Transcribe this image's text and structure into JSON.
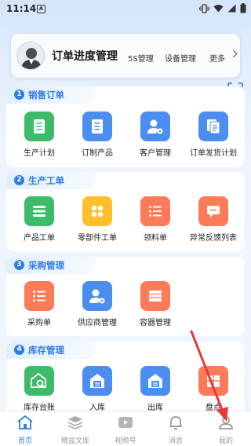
{
  "status_bar": {
    "time": "11:14",
    "notif_letter": "A"
  },
  "header": {
    "title": "订单进度管理",
    "tabs": [
      "5S管理",
      "设备管理",
      "更多"
    ]
  },
  "sections": [
    {
      "num": "1",
      "title": "销售订单",
      "items": [
        {
          "label": "生产计划",
          "color": "#3dba6a",
          "icon": "document-icon"
        },
        {
          "label": "订制产品",
          "color": "#4b8ef0",
          "icon": "document-icon"
        },
        {
          "label": "客户管理",
          "color": "#4b8ef0",
          "icon": "user-gear-icon"
        },
        {
          "label": "订单发货计划",
          "color": "#4b8ef0",
          "icon": "copy-document-icon"
        }
      ]
    },
    {
      "num": "2",
      "title": "生产工单",
      "items": [
        {
          "label": "产品工单",
          "color": "#3dba6a",
          "icon": "list-icon"
        },
        {
          "label": "零部件工单",
          "color": "#ffbf2a",
          "icon": "grid-dots-icon"
        },
        {
          "label": "领料单",
          "color": "#ff7a58",
          "icon": "list-icon"
        },
        {
          "label": "异常反馈列表",
          "color": "#ff7a58",
          "icon": "message-icon"
        }
      ]
    },
    {
      "num": "3",
      "title": "采购管理",
      "items": [
        {
          "label": "采购单",
          "color": "#ff7a58",
          "icon": "list-icon"
        },
        {
          "label": "供应商管理",
          "color": "#4b8ef0",
          "icon": "user-gear-icon"
        },
        {
          "label": "容器管理",
          "color": "#ff7a58",
          "icon": "table-icon"
        }
      ]
    },
    {
      "num": "4",
      "title": "库存管理",
      "items": [
        {
          "label": "库存台账",
          "color": "#3dba6a",
          "icon": "warehouse-search-icon"
        },
        {
          "label": "入库",
          "color": "#4b8ef0",
          "icon": "warehouse-in-icon"
        },
        {
          "label": "出库",
          "color": "#4b8ef0",
          "icon": "warehouse-out-icon"
        },
        {
          "label": "盘点",
          "color": "#ff7a58",
          "icon": "inventory-icon"
        }
      ]
    }
  ],
  "bottom_nav": [
    {
      "label": "首页",
      "active": true,
      "icon": "home-icon"
    },
    {
      "label": "精益文库",
      "active": false,
      "icon": "layers-icon"
    },
    {
      "label": "视频号",
      "active": false,
      "icon": "video-icon"
    },
    {
      "label": "消息",
      "active": false,
      "icon": "bell-icon"
    },
    {
      "label": "我的",
      "active": false,
      "icon": "profile-icon"
    }
  ],
  "colors": {
    "accent": "#2f7de6",
    "arrow": "#e53935"
  }
}
